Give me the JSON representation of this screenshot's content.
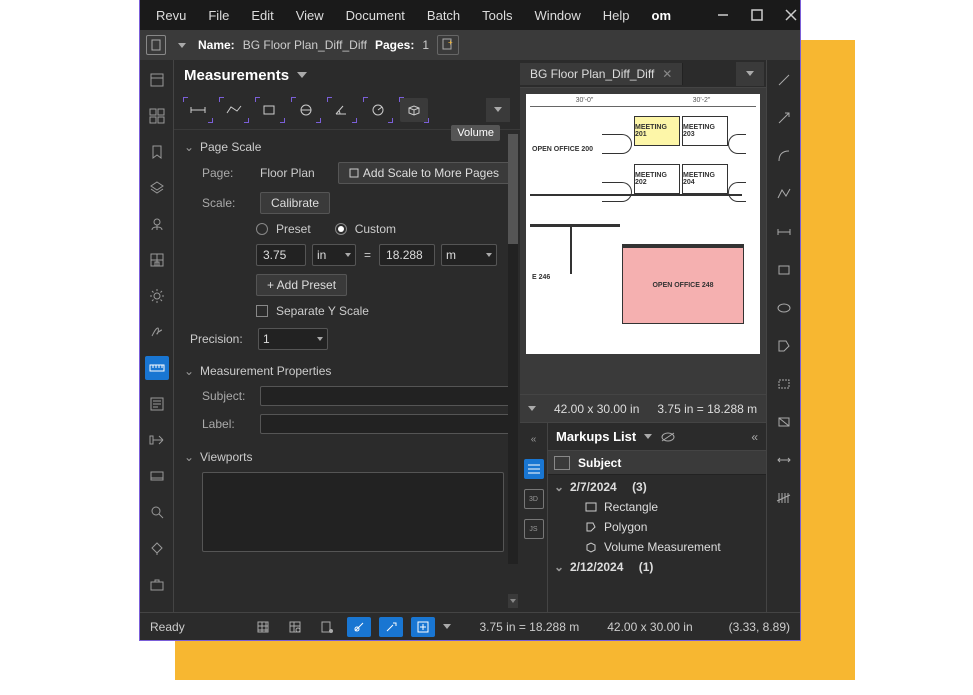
{
  "menubar": {
    "items": [
      "Revu",
      "File",
      "Edit",
      "View",
      "Document",
      "Batch",
      "Tools",
      "Window",
      "Help"
    ],
    "om": "om"
  },
  "doc_header": {
    "name_label": "Name:",
    "name_value": "BG Floor Plan_Diff_Diff",
    "pages_label": "Pages:",
    "pages_value": "1"
  },
  "measurements": {
    "title": "Measurements",
    "tooltip": "Volume",
    "page_scale": {
      "header": "Page Scale",
      "page_label": "Page:",
      "page_value": "Floor Plan",
      "add_scale_btn": "Add Scale to More Pages",
      "scale_label": "Scale:",
      "calibrate_btn": "Calibrate",
      "preset_label": "Preset",
      "custom_label": "Custom",
      "scale_from": "3.75",
      "scale_from_unit": "in",
      "equals": "=",
      "scale_to": "18.288",
      "scale_to_unit": "m",
      "add_preset_btn": "+ Add Preset",
      "separate_y": "Separate Y Scale"
    },
    "precision": {
      "label": "Precision:",
      "value": "1"
    },
    "properties": {
      "header": "Measurement Properties",
      "subject_label": "Subject:",
      "label_label": "Label:"
    },
    "viewports": {
      "header": "Viewports"
    }
  },
  "doc_tab": {
    "name": "BG Floor Plan_Diff_Diff"
  },
  "floorplan": {
    "dims": [
      "30'-0\"",
      "30'-2\""
    ],
    "rooms": {
      "meeting_201": "MEETING 201",
      "meeting_203": "MEETING 203",
      "meeting_202": "MEETING 202",
      "meeting_204": "MEETING 204",
      "open_office_200": "OPEN OFFICE 200",
      "open_office_248": "OPEN OFFICE 248",
      "e_246": "E 246"
    }
  },
  "canvas_status": {
    "size": "42.00 x 30.00 in",
    "scale": "3.75 in = 18.288 m"
  },
  "markups": {
    "title": "Markups List",
    "col_subject": "Subject",
    "groups": [
      {
        "date": "2/7/2024",
        "count": "(3)",
        "items": [
          "Rectangle",
          "Polygon",
          "Volume Measurement"
        ]
      },
      {
        "date": "2/12/2024",
        "count": "(1)",
        "items": []
      }
    ]
  },
  "status": {
    "ready": "Ready",
    "scale": "3.75 in = 18.288 m",
    "size": "42.00 x 30.00 in",
    "coords": "(3.33, 8.89)"
  }
}
